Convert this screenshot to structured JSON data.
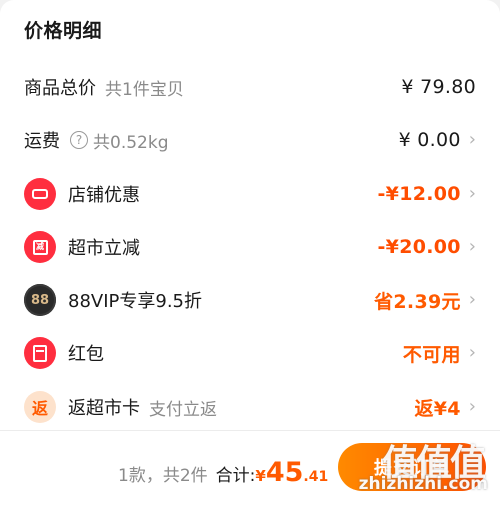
{
  "title": "价格明细",
  "rows": [
    {
      "label": "商品总价",
      "sub": "共1件宝贝",
      "amount": "¥ 79.80"
    },
    {
      "label": "运费",
      "help": "?",
      "sub": "共0.52kg",
      "amount": "¥ 0.00",
      "chevron": "›"
    },
    {
      "label": "店铺优惠",
      "amount": "-¥12.00",
      "chevron": "›",
      "icon": "ticket-icon"
    },
    {
      "label": "超市立减",
      "icon_text": "减",
      "amount": "-¥20.00",
      "chevron": "›",
      "icon": "reduce-icon"
    },
    {
      "label": "88VIP专享9.5折",
      "icon_text": "88",
      "amount": "省2.39元",
      "chevron": "›",
      "icon": "vip-88-icon"
    },
    {
      "label": "红包",
      "amount": "不可用",
      "chevron": "›",
      "icon": "red-envelope-icon"
    },
    {
      "label": "返超市卡",
      "icon_text": "返",
      "sub": "支付立返",
      "amount": "返¥4",
      "chevron": "›",
      "icon": "rebate-icon"
    }
  ],
  "footer": {
    "count": "1款，共2件",
    "total_label": "合计:",
    "currency": "¥",
    "total_int": "45",
    "total_dec": ".41",
    "submit_label": "提交订单"
  },
  "watermark": {
    "logo": "值值值",
    "url": "zhizhizhi.com"
  },
  "colors": {
    "accent": "#ff5a00",
    "discount_red": "#ff4d00",
    "icon_red": "#ff2e3f",
    "button_start": "#ff8a00",
    "button_end": "#ff5000"
  }
}
